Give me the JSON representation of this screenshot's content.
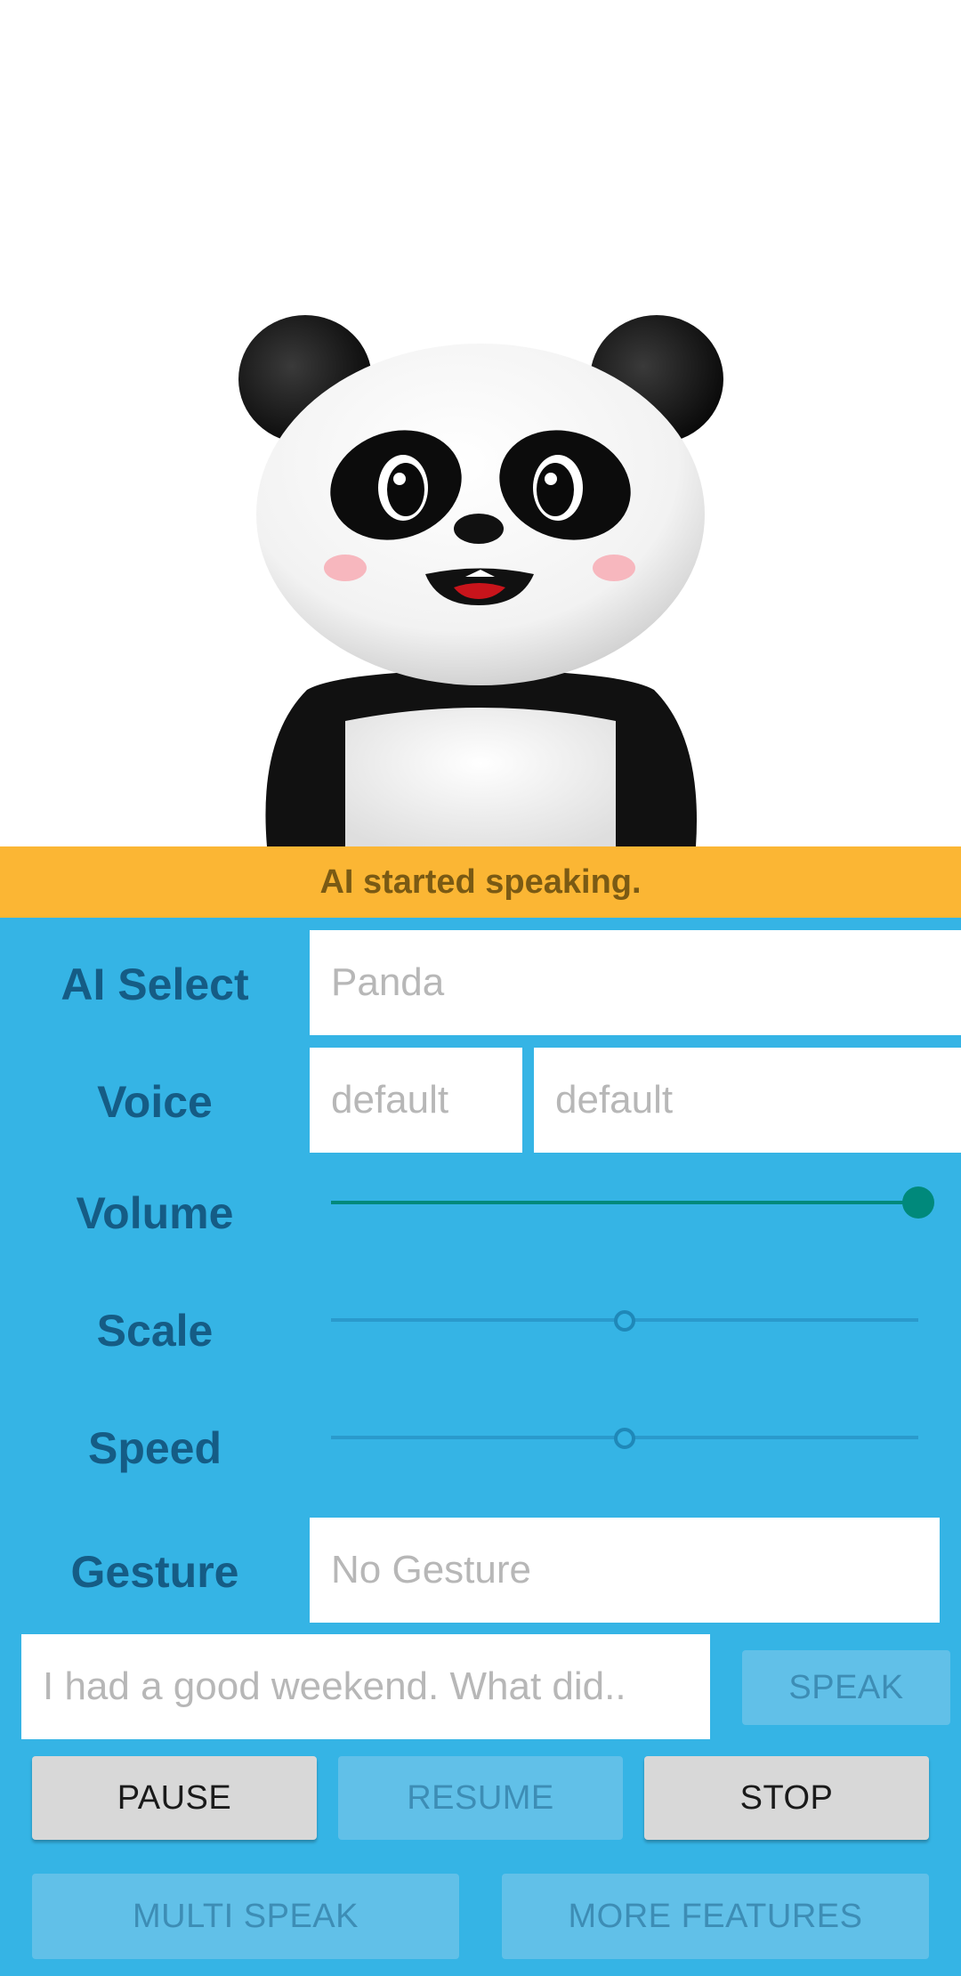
{
  "status": {
    "message": "AI started speaking."
  },
  "form": {
    "ai_select": {
      "label": "AI Select",
      "value": "Panda"
    },
    "voice": {
      "label": "Voice",
      "value_left": "default",
      "value_right": "default"
    },
    "volume": {
      "label": "Volume",
      "level": 1.0
    },
    "scale": {
      "label": "Scale",
      "level": 0.5
    },
    "speed": {
      "label": "Speed",
      "level": 0.5
    },
    "gesture": {
      "label": "Gesture",
      "value": "No Gesture"
    }
  },
  "speak": {
    "placeholder": "I had a good weekend. What did..",
    "speak_label": "SPEAK"
  },
  "controls": {
    "pause": "PAUSE",
    "resume": "RESUME",
    "stop": "STOP"
  },
  "footer": {
    "multi_speak": "MULTI SPEAK",
    "more_features": "MORE FEATURES"
  },
  "colors": {
    "status_bar": "#FBB634",
    "panel": "#35B4E5",
    "label": "#155C85",
    "slider_active": "#00897B"
  }
}
